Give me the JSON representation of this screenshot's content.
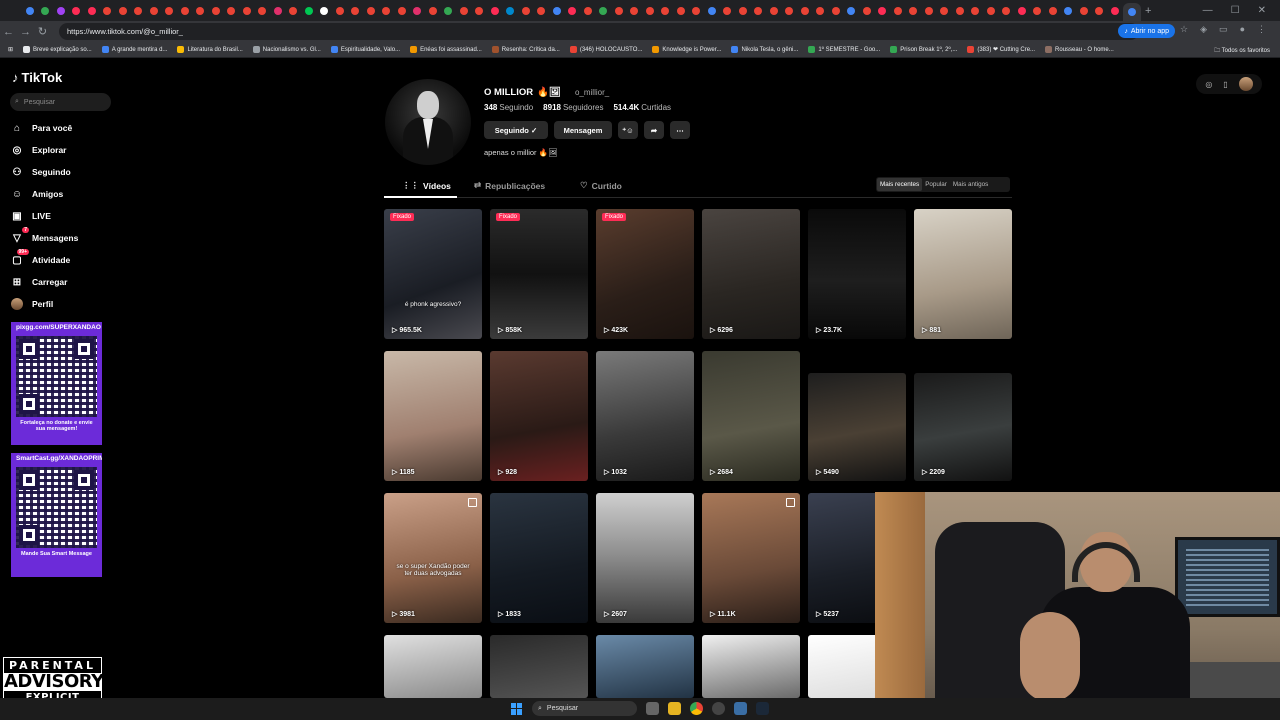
{
  "browser": {
    "url": "https://www.tiktok.com/@o_millior_",
    "open_app_label": "Abrir no app",
    "bookmarks": [
      "Breve explicação so...",
      "A grande mentira d...",
      "Literatura do Brasil...",
      "Nacionalismo vs. Gl...",
      "Espiritualidade, Valo...",
      "Enéas foi assassinad...",
      "Resenha: Crítica da...",
      "(346) HOLOCAUSTO...",
      "Knowledge is Power...",
      "Nikola Tesla, o gêni...",
      "1º SEMESTRE - Goo...",
      "Prison Break 1º, 2º,...",
      "(383) ❤ Cutting Cre...",
      "Rousseau - O home..."
    ],
    "bookmarks_all": "Todos os favoritos"
  },
  "sidebar": {
    "logo": "TikTok",
    "search_placeholder": "Pesquisar",
    "items": [
      {
        "label": "Para você",
        "icon": "home-icon"
      },
      {
        "label": "Explorar",
        "icon": "compass-icon"
      },
      {
        "label": "Seguindo",
        "icon": "following-icon"
      },
      {
        "label": "Amigos",
        "icon": "friends-icon"
      },
      {
        "label": "LIVE",
        "icon": "live-icon"
      },
      {
        "label": "Mensagens",
        "icon": "messages-icon",
        "badge": "7"
      },
      {
        "label": "Atividade",
        "icon": "activity-icon",
        "badge": "99+"
      },
      {
        "label": "Carregar",
        "icon": "upload-icon"
      },
      {
        "label": "Perfil",
        "icon": "profile-icon"
      }
    ]
  },
  "overlay": {
    "qr1_title": "pixgg.com/SUPERXANDAO",
    "qr1_footer": "Fortaleça no donate e envie sua mensagem!",
    "qr2_title": "SmartCast.gg/XANDAOPRIME",
    "qr2_footer": "Mande Sua Smart Message",
    "advisory_line1": "PARENTAL",
    "advisory_line2": "ADVISORY",
    "advisory_line3": "EXPLICIT CONTENT"
  },
  "profile": {
    "name": "O MILLIOR",
    "name_emoji": "🔥🖼",
    "handle": "o_millior_",
    "following_count": "348",
    "following_label": "Seguindo",
    "followers_count": "8918",
    "followers_label": "Seguidores",
    "likes_count": "514.4K",
    "likes_label": "Curtidas",
    "btn_following": "Seguindo ✓",
    "btn_message": "Mensagem",
    "bio": "apenas o millior 🔥🖼"
  },
  "tabs": {
    "videos": "Vídeos",
    "reposts": "Republicações",
    "liked": "Curtido"
  },
  "sort": {
    "recent": "Mais recentes",
    "popular": "Popular",
    "oldest": "Mais antigos"
  },
  "pinned_label": "Fixado",
  "videos": [
    {
      "count": "965.5K",
      "pinned": true,
      "caption": "é phonk agressivo?"
    },
    {
      "count": "858K",
      "pinned": true,
      "caption": ""
    },
    {
      "count": "423K",
      "pinned": true,
      "caption": ""
    },
    {
      "count": "6296",
      "pinned": false,
      "caption": ""
    },
    {
      "count": "23.7K",
      "pinned": false,
      "caption": ""
    },
    {
      "count": "881",
      "pinned": false,
      "caption": ""
    },
    {
      "count": "1185",
      "pinned": false,
      "caption": ""
    },
    {
      "count": "928",
      "pinned": false,
      "caption": ""
    },
    {
      "count": "1032",
      "pinned": false,
      "caption": ""
    },
    {
      "count": "2684",
      "pinned": false,
      "caption": ""
    },
    {
      "count": "5490",
      "pinned": false,
      "caption": ""
    },
    {
      "count": "2209",
      "pinned": false,
      "caption": ""
    },
    {
      "count": "3981",
      "pinned": false,
      "caption": "se o super Xandão poder ter duas advogadas"
    },
    {
      "count": "1833",
      "pinned": false,
      "caption": ""
    },
    {
      "count": "2607",
      "pinned": false,
      "caption": ""
    },
    {
      "count": "11.1K",
      "pinned": false,
      "caption": ""
    },
    {
      "count": "5237",
      "pinned": false,
      "caption": ""
    }
  ],
  "taskbar": {
    "search_placeholder": "Pesquisar"
  }
}
